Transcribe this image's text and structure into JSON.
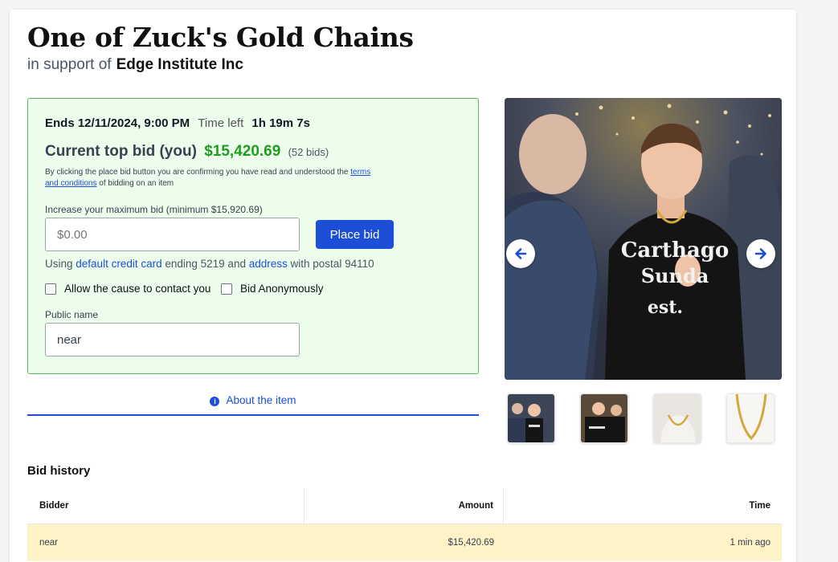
{
  "item": {
    "title": "One of Zuck's Gold Chains",
    "support_prefix": "in support of",
    "organization": "Edge Institute Inc"
  },
  "bid_panel": {
    "ends_label": "Ends 12/11/2024, 9:00 PM",
    "time_left_label": "Time left",
    "time_left_value": "1h 19m 7s",
    "current_top_label": "Current top bid (you)",
    "current_top_amount": "$15,420.69",
    "bid_count": "(52 bids)",
    "terms_prefix": "By clicking the place bid button you are confirming you have read and understood the",
    "terms_link": "terms and conditions",
    "terms_suffix": "of bidding on an item",
    "increase_label": "Increase your maximum bid (minimum $15,920.69)",
    "bid_placeholder": "$0.00",
    "place_bid_label": "Place bid",
    "using_prefix": "Using",
    "card_link": "default credit card",
    "card_suffix": "ending 5219 and",
    "address_link": "address",
    "address_suffix": "with postal 94110",
    "contact_checkbox_label": "Allow the cause to contact you",
    "anonymous_checkbox_label": "Bid Anonymously",
    "public_name_label": "Public name",
    "public_name_value": "near"
  },
  "about_tab": {
    "label": "About the item"
  },
  "gallery": {
    "main_caption_text": [
      "Carthago",
      "Sunda",
      "est."
    ],
    "thumbnails": [
      "thumb-1",
      "thumb-2",
      "thumb-3",
      "thumb-4"
    ]
  },
  "bid_history": {
    "title": "Bid history",
    "columns": [
      "Bidder",
      "Amount",
      "Time"
    ],
    "rows": [
      {
        "bidder": "near",
        "amount": "$15,420.69",
        "time": "1 min ago"
      }
    ]
  },
  "colors": {
    "accent": "#1d4ed8",
    "bid_green": "#1f9d1f",
    "panel_bg": "#ecfdec",
    "panel_border": "#59b959",
    "highlight_row": "#fef3c7"
  }
}
